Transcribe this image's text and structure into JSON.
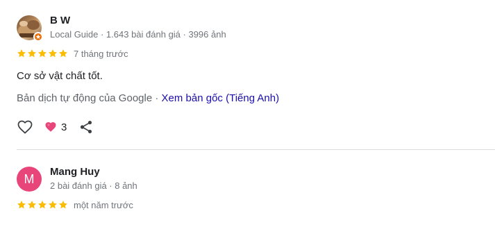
{
  "reviews": [
    {
      "name": "B W",
      "meta": "Local Guide · 1.643 bài đánh giá · 3996 ảnh",
      "rating": 5,
      "time": "7 tháng trước",
      "text": "Cơ sở vật chất tốt.",
      "translation_note": "Bản dịch tự động của Google",
      "translation_sep": " · ",
      "translation_link": "Xem bản gốc (Tiếng Anh)",
      "reaction_count": "3",
      "avatar_icon": "guide-photo-avatar",
      "badge_icon": "local-guide-star-icon"
    },
    {
      "name": "Mang Huy",
      "meta": "2 bài đánh giá · 8 ảnh",
      "rating": 5,
      "time": "một năm trước",
      "avatar_letter": "M",
      "avatar_color": "#e8457a"
    }
  ],
  "colors": {
    "star": "#fbbc04",
    "link": "#1a0dab",
    "meta": "#70757a",
    "reaction_heart": "#e8457a",
    "guide_badge": "#e8710a"
  },
  "icons": {
    "like": "heart-outline-icon",
    "reaction": "heart-filled-icon",
    "share": "share-icon",
    "star": "star-icon"
  }
}
